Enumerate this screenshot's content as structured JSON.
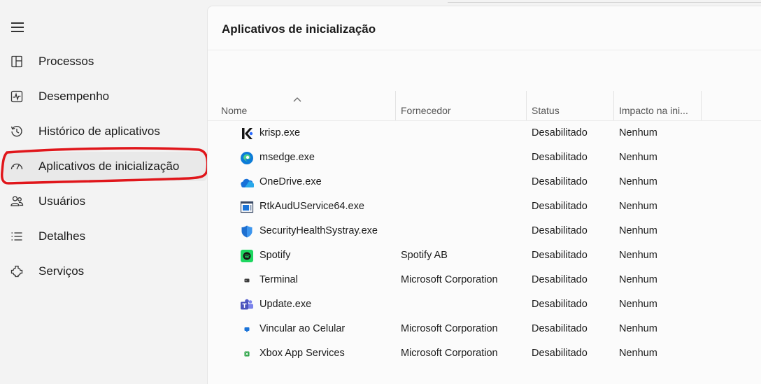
{
  "sidebar": {
    "items": [
      {
        "label": "Processos",
        "icon": "processes-icon"
      },
      {
        "label": "Desempenho",
        "icon": "performance-icon"
      },
      {
        "label": "Histórico de aplicativos",
        "icon": "history-icon"
      },
      {
        "label": "Aplicativos de inicialização",
        "icon": "startup-icon",
        "active": true
      },
      {
        "label": "Usuários",
        "icon": "users-icon"
      },
      {
        "label": "Detalhes",
        "icon": "details-icon"
      },
      {
        "label": "Serviços",
        "icon": "services-icon"
      }
    ]
  },
  "page": {
    "title": "Aplicativos de inicialização"
  },
  "table": {
    "columns": [
      "Nome",
      "Fornecedor",
      "Status",
      "Impacto na ini..."
    ],
    "rows": [
      {
        "name": "krisp.exe",
        "vendor": "",
        "status": "Desabilitado",
        "impact": "Nenhum",
        "icon": "krisp-icon"
      },
      {
        "name": "msedge.exe",
        "vendor": "",
        "status": "Desabilitado",
        "impact": "Nenhum",
        "icon": "edge-icon"
      },
      {
        "name": "OneDrive.exe",
        "vendor": "",
        "status": "Desabilitado",
        "impact": "Nenhum",
        "icon": "onedrive-icon"
      },
      {
        "name": "RtkAudUService64.exe",
        "vendor": "",
        "status": "Desabilitado",
        "impact": "Nenhum",
        "icon": "realtek-icon"
      },
      {
        "name": "SecurityHealthSystray.exe",
        "vendor": "",
        "status": "Desabilitado",
        "impact": "Nenhum",
        "icon": "shield-icon"
      },
      {
        "name": "Spotify",
        "vendor": "Spotify AB",
        "status": "Desabilitado",
        "impact": "Nenhum",
        "icon": "spotify-icon"
      },
      {
        "name": "Terminal",
        "vendor": "Microsoft Corporation",
        "status": "Desabilitado",
        "impact": "Nenhum",
        "icon": "terminal-icon"
      },
      {
        "name": "Update.exe",
        "vendor": "",
        "status": "Desabilitado",
        "impact": "Nenhum",
        "icon": "teams-icon"
      },
      {
        "name": "Vincular ao Celular",
        "vendor": "Microsoft Corporation",
        "status": "Desabilitado",
        "impact": "Nenhum",
        "icon": "phone-link-icon"
      },
      {
        "name": "Xbox App Services",
        "vendor": "Microsoft Corporation",
        "status": "Desabilitado",
        "impact": "Nenhum",
        "icon": "xbox-icon"
      }
    ]
  },
  "colors": {
    "highlight_annotation": "#e0161b",
    "active_bg": "#e9e9e9",
    "content_bg": "#fbfbfb",
    "sidebar_bg": "#f3f3f3"
  }
}
